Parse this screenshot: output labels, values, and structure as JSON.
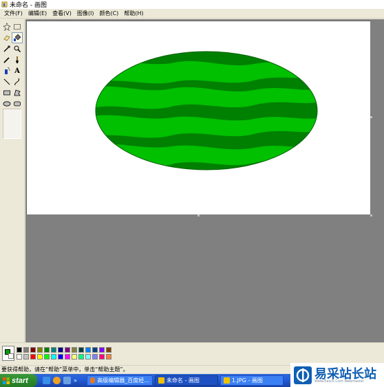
{
  "window": {
    "title": "未命名 - 画图",
    "icon": "paint-icon"
  },
  "menu": {
    "items": [
      "文件(F)",
      "编辑(E)",
      "查看(V)",
      "图像(I)",
      "颜色(C)",
      "帮助(H)"
    ]
  },
  "toolbox": {
    "tools": [
      {
        "name": "free-form-select-icon"
      },
      {
        "name": "rect-select-icon"
      },
      {
        "name": "eraser-icon"
      },
      {
        "name": "fill-bucket-icon",
        "active": true
      },
      {
        "name": "color-picker-icon"
      },
      {
        "name": "magnifier-icon"
      },
      {
        "name": "pencil-icon"
      },
      {
        "name": "brush-icon"
      },
      {
        "name": "airbrush-icon"
      },
      {
        "name": "text-icon",
        "glyph": "A"
      },
      {
        "name": "line-icon"
      },
      {
        "name": "curve-icon"
      },
      {
        "name": "rectangle-icon"
      },
      {
        "name": "polygon-icon"
      },
      {
        "name": "ellipse-icon"
      },
      {
        "name": "rounded-rect-icon"
      }
    ]
  },
  "canvas": {
    "drawing": "watermelon",
    "colors": {
      "rind_dark": "#008000",
      "stripe_light": "#00c000",
      "outline": "#006000"
    }
  },
  "palette": {
    "foreground": "#00a000",
    "background": "#ffffff",
    "row1": [
      "#000000",
      "#808080",
      "#800000",
      "#808000",
      "#008000",
      "#008080",
      "#000080",
      "#800080",
      "#808040",
      "#004040",
      "#0080ff",
      "#004080",
      "#8000ff",
      "#804000"
    ],
    "row2": [
      "#ffffff",
      "#c0c0c0",
      "#ff0000",
      "#ffff00",
      "#00ff00",
      "#00ffff",
      "#0000ff",
      "#ff00ff",
      "#ffff80",
      "#00ff80",
      "#80ffff",
      "#8080ff",
      "#ff0080",
      "#ff8040"
    ]
  },
  "status": {
    "text": "要获得帮助，请在“帮助”菜单中，单击“帮助主题”。"
  },
  "taskbar": {
    "start_label": "start",
    "tasks": [
      {
        "label": "高级编辑器_百度经...",
        "active": false,
        "icon_color": "#e87722"
      },
      {
        "label": "未命名 - 画图",
        "active": true,
        "icon_color": "#f0c000"
      },
      {
        "label": "1.JPG - 画图",
        "active": false,
        "icon_color": "#f0c000"
      }
    ],
    "chevron": "»"
  },
  "watermark": {
    "title": "易采站长站",
    "subtitle": "Www.Easck.Com Webmaster"
  }
}
